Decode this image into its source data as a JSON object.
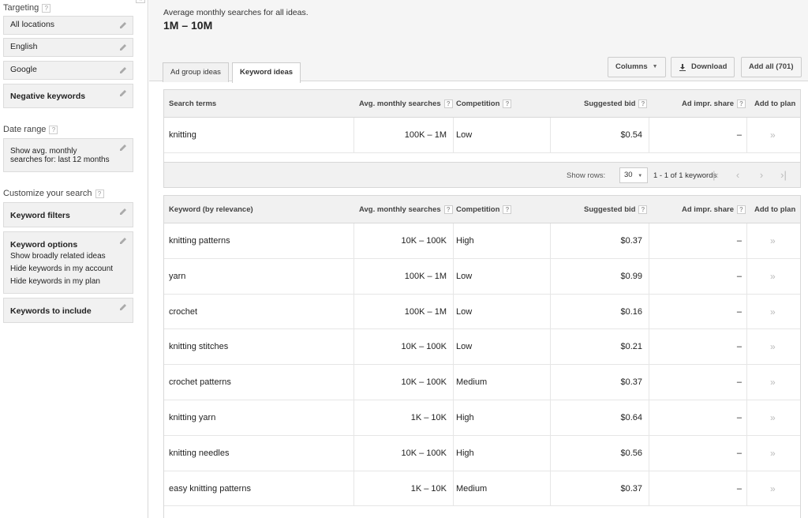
{
  "sidebar": {
    "targeting_title": "Targeting",
    "targeting": [
      "All locations",
      "English",
      "Google",
      "Negative keywords"
    ],
    "date_range_title": "Date range",
    "date_range_value": "Show avg. monthly searches for: last 12 months",
    "customize_title": "Customize your search",
    "keyword_filters": "Keyword filters",
    "keyword_options_title": "Keyword options",
    "keyword_options": [
      "Show broadly related ideas",
      "Hide keywords in my account",
      "Hide keywords in my plan"
    ],
    "keywords_to_include": "Keywords to include"
  },
  "summary": {
    "label": "Average monthly searches for all ideas.",
    "value": "1M – 10M"
  },
  "tabs": [
    "Ad group ideas",
    "Keyword ideas"
  ],
  "toolbar": {
    "columns": "Columns",
    "download": "Download",
    "add_all": "Add all (701)"
  },
  "search_table": {
    "headers": [
      "Search terms",
      "Avg. monthly searches",
      "Competition",
      "Suggested bid",
      "Ad impr. share",
      "Add to plan"
    ],
    "rows": [
      {
        "keyword": "knitting",
        "searches": "100K – 1M",
        "competition": "Low",
        "bid": "$0.54",
        "share": "–"
      }
    ]
  },
  "pager": {
    "show_rows_label": "Show rows:",
    "rows_value": "30",
    "info": "1 - 1 of 1 keywords"
  },
  "ideas_table": {
    "headers": [
      "Keyword (by relevance)",
      "Avg. monthly searches",
      "Competition",
      "Suggested bid",
      "Ad impr. share",
      "Add to plan"
    ],
    "rows": [
      {
        "keyword": "knitting patterns",
        "searches": "10K – 100K",
        "competition": "High",
        "bid": "$0.37",
        "share": "–"
      },
      {
        "keyword": "yarn",
        "searches": "100K – 1M",
        "competition": "Low",
        "bid": "$0.99",
        "share": "–"
      },
      {
        "keyword": "crochet",
        "searches": "100K – 1M",
        "competition": "Low",
        "bid": "$0.16",
        "share": "–"
      },
      {
        "keyword": "knitting stitches",
        "searches": "10K – 100K",
        "competition": "Low",
        "bid": "$0.21",
        "share": "–"
      },
      {
        "keyword": "crochet patterns",
        "searches": "10K – 100K",
        "competition": "Medium",
        "bid": "$0.37",
        "share": "–"
      },
      {
        "keyword": "knitting yarn",
        "searches": "1K – 10K",
        "competition": "High",
        "bid": "$0.64",
        "share": "–"
      },
      {
        "keyword": "knitting needles",
        "searches": "10K – 100K",
        "competition": "High",
        "bid": "$0.56",
        "share": "–"
      },
      {
        "keyword": "easy knitting patterns",
        "searches": "1K – 10K",
        "competition": "Medium",
        "bid": "$0.37",
        "share": "–"
      }
    ]
  },
  "icons": {
    "edit": "pencil-icon",
    "help": "help-icon",
    "add": "chevron-double-right-icon",
    "download": "download-icon"
  },
  "colors": {
    "panel_bg": "#f1f1f1",
    "border": "#d8d8d8",
    "muted_icon": "#bbbbbb"
  }
}
